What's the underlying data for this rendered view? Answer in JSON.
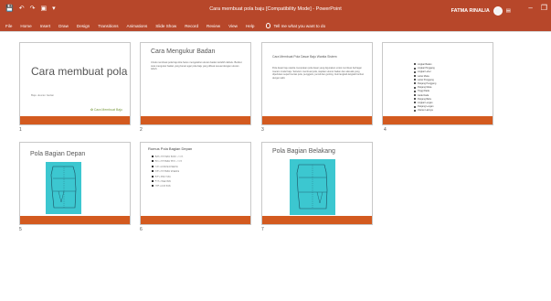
{
  "window": {
    "title": "Cara membuat pola baju [Compatibility Mode] - PowerPoint",
    "user_name": "FATMA RINALIA",
    "quick_access": [
      "save-icon",
      "undo-icon",
      "redo-icon",
      "present-icon",
      "customize-icon"
    ],
    "controls": [
      "minimize-icon",
      "restore-icon"
    ]
  },
  "ribbon": {
    "tabs": [
      "File",
      "Home",
      "Insert",
      "Draw",
      "Design",
      "Transitions",
      "Animations",
      "Slide Show",
      "Record",
      "Review",
      "View",
      "Help"
    ],
    "tell_me": "Tell me what you want to do"
  },
  "slides": [
    {
      "number": "1",
      "title": "Cara membuat pola",
      "subtitle": "Baju ukuran badan",
      "logo": "Cara Membuat Baju"
    },
    {
      "number": "2",
      "title": "Cara Mengukur Badan",
      "body": "Untuk membuat pola baju kita harus mengetahui ukuran badan terlebih dahulu. Berikut cara mengukur badan yang benar agar pola baju yang dibuat sesuai dengan ukuran tubuh."
    },
    {
      "number": "3",
      "title": "Cara Membuat Pola Dasar Baju Wanita Sistem",
      "body": "Pola dasar baju wanita merupakan pola dasar yang digunakan untuk membuat berbagai macam model baju. Sebelum membuat pola, siapkan ukuran badan dan alat-alat yang diperlukan seperti kertas pola, penggaris, pensil dan gunting. Ikuti langkah-langkah berikut dengan teliti."
    },
    {
      "number": "4",
      "items": [
        "Lingkar Badan",
        "Lingkar Pinggang",
        "Lingkar Leher",
        "Lebar Muka",
        "Lebar Punggung",
        "Panjang Punggung",
        "Panjang Muka",
        "Tinggi Dada",
        "Jarak Dada",
        "Panjang Bahu",
        "Lingkar Lengan",
        "Panjang Lengan",
        "Ukuran Lainnya"
      ]
    },
    {
      "number": "5",
      "title": "Pola Bagian Depan"
    },
    {
      "number": "6",
      "title": "Rumus Pola Bagian Depan",
      "items": [
        "A-B = 1/2 lingkar badan + 1 cm",
        "B-C = 1/6 lingkar leher + 1 cm",
        "C-D = panjang punggung",
        "D-E = 1/4 lingkar pinggang",
        "E-F = lebar muka",
        "F-G = tinggi dada",
        "G-H = jarak dada"
      ]
    },
    {
      "number": "7",
      "title": "Pola Bagian Belakang"
    }
  ],
  "colors": {
    "accent": "#b7472a",
    "slide_bar": "#d35a1f",
    "pattern_bg": "#3cc7d0"
  }
}
